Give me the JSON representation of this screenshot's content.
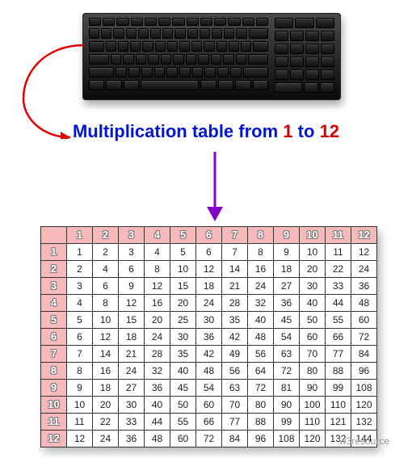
{
  "heading": {
    "prefix": "Multiplication table from",
    "range_start": "1",
    "range_mid": "to",
    "range_end": "12"
  },
  "watermark": "w3resource",
  "chart_data": {
    "type": "table",
    "title": "Multiplication table from 1 to 12",
    "size": 12,
    "col_headers": [
      1,
      2,
      3,
      4,
      5,
      6,
      7,
      8,
      9,
      10,
      11,
      12
    ],
    "row_headers": [
      1,
      2,
      3,
      4,
      5,
      6,
      7,
      8,
      9,
      10,
      11,
      12
    ],
    "rows": [
      [
        1,
        2,
        3,
        4,
        5,
        6,
        7,
        8,
        9,
        10,
        11,
        12
      ],
      [
        2,
        4,
        6,
        8,
        10,
        12,
        14,
        16,
        18,
        20,
        22,
        24
      ],
      [
        3,
        6,
        9,
        12,
        15,
        18,
        21,
        24,
        27,
        30,
        33,
        36
      ],
      [
        4,
        8,
        12,
        16,
        20,
        24,
        28,
        32,
        36,
        40,
        44,
        48
      ],
      [
        5,
        10,
        15,
        20,
        25,
        30,
        35,
        40,
        45,
        50,
        55,
        60
      ],
      [
        6,
        12,
        18,
        24,
        30,
        36,
        42,
        48,
        54,
        60,
        66,
        72
      ],
      [
        7,
        14,
        21,
        28,
        35,
        42,
        49,
        56,
        63,
        70,
        77,
        84
      ],
      [
        8,
        16,
        24,
        32,
        40,
        48,
        56,
        64,
        72,
        80,
        88,
        96
      ],
      [
        9,
        18,
        27,
        36,
        45,
        54,
        63,
        72,
        81,
        90,
        99,
        108
      ],
      [
        10,
        20,
        30,
        40,
        50,
        60,
        70,
        80,
        90,
        100,
        110,
        120
      ],
      [
        11,
        22,
        33,
        44,
        55,
        66,
        77,
        88,
        99,
        110,
        121,
        132
      ],
      [
        12,
        24,
        36,
        48,
        60,
        72,
        84,
        96,
        108,
        120,
        132,
        144
      ]
    ]
  }
}
